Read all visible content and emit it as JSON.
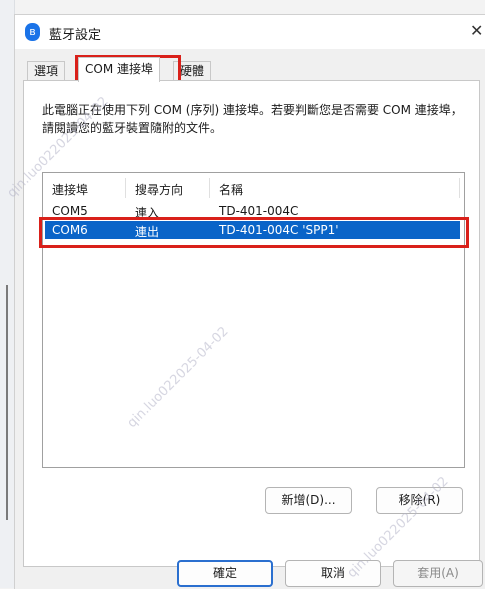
{
  "window": {
    "title": "藍牙設定",
    "close_glyph": "✕"
  },
  "tabs": [
    {
      "label": "選項"
    },
    {
      "label": "COM 連接埠",
      "active": true
    },
    {
      "label": "硬體"
    }
  ],
  "description": "此電腦正在使用下列 COM (序列) 連接埠。若要判斷您是否需要 COM 連接埠，請閱讀您的藍牙裝置隨附的文件。",
  "table": {
    "headers": [
      "連接埠",
      "搜尋方向",
      "名稱"
    ],
    "rows": [
      {
        "port": "COM5",
        "direction": "連入",
        "name": "TD-401-004C",
        "selected": false
      },
      {
        "port": "COM6",
        "direction": "連出",
        "name": "TD-401-004C 'SPP1'",
        "selected": true
      }
    ]
  },
  "panel_buttons": {
    "add": "新增(D)...",
    "remove": "移除(R)"
  },
  "footer_buttons": {
    "ok": "確定",
    "cancel": "取消",
    "apply": "套用(A)"
  },
  "watermark": {
    "text": "qin.luo022025-04-02"
  },
  "colors": {
    "selection": "#0a64c8",
    "highlight": "#d9201a",
    "bluetooth": "#1a73e8"
  }
}
